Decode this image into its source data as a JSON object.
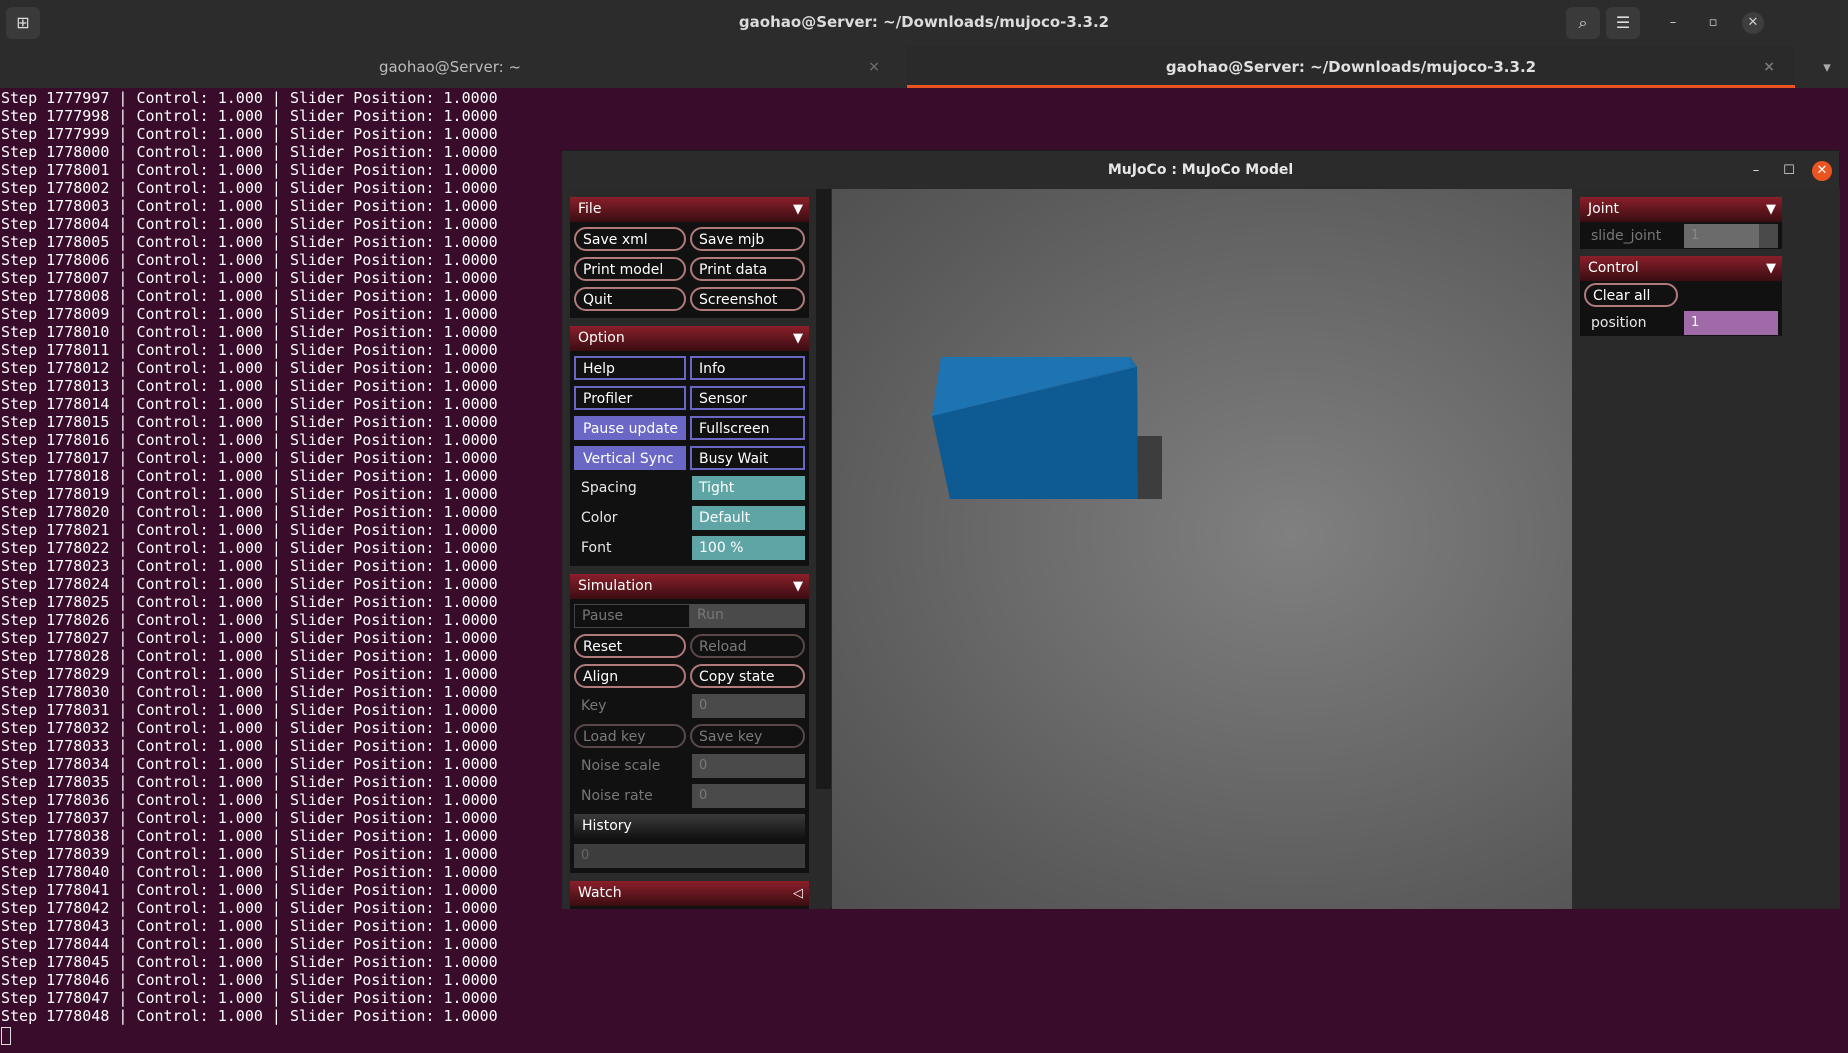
{
  "terminal_window": {
    "title": "gaohao@Server: ~/Downloads/mujoco-3.3.2",
    "tabs": [
      {
        "label": "gaohao@Server: ~",
        "active": false
      },
      {
        "label": "gaohao@Server: ~/Downloads/mujoco-3.3.2",
        "active": true
      }
    ],
    "icons": {
      "new_tab": "new-tab-icon",
      "search": "search-icon",
      "menu": "hamburger-menu-icon",
      "minimize": "minimize-icon",
      "maximize": "maximize-icon",
      "close": "close-icon",
      "tab_close": "×",
      "tab_dropdown": "▾"
    },
    "output_lines": [
      "Step 1777997 | Control: 1.000 | Slider Position: 1.0000",
      "Step 1777998 | Control: 1.000 | Slider Position: 1.0000",
      "Step 1777999 | Control: 1.000 | Slider Position: 1.0000",
      "Step 1778000 | Control: 1.000 | Slider Position: 1.0000",
      "Step 1778001 | Control: 1.000 | Slider Position: 1.0000",
      "Step 1778002 | Control: 1.000 | Slider Position: 1.0000",
      "Step 1778003 | Control: 1.000 | Slider Position: 1.0000",
      "Step 1778004 | Control: 1.000 | Slider Position: 1.0000",
      "Step 1778005 | Control: 1.000 | Slider Position: 1.0000",
      "Step 1778006 | Control: 1.000 | Slider Position: 1.0000",
      "Step 1778007 | Control: 1.000 | Slider Position: 1.0000",
      "Step 1778008 | Control: 1.000 | Slider Position: 1.0000",
      "Step 1778009 | Control: 1.000 | Slider Position: 1.0000",
      "Step 1778010 | Control: 1.000 | Slider Position: 1.0000",
      "Step 1778011 | Control: 1.000 | Slider Position: 1.0000",
      "Step 1778012 | Control: 1.000 | Slider Position: 1.0000",
      "Step 1778013 | Control: 1.000 | Slider Position: 1.0000",
      "Step 1778014 | Control: 1.000 | Slider Position: 1.0000",
      "Step 1778015 | Control: 1.000 | Slider Position: 1.0000",
      "Step 1778016 | Control: 1.000 | Slider Position: 1.0000",
      "Step 1778017 | Control: 1.000 | Slider Position: 1.0000",
      "Step 1778018 | Control: 1.000 | Slider Position: 1.0000",
      "Step 1778019 | Control: 1.000 | Slider Position: 1.0000",
      "Step 1778020 | Control: 1.000 | Slider Position: 1.0000",
      "Step 1778021 | Control: 1.000 | Slider Position: 1.0000",
      "Step 1778022 | Control: 1.000 | Slider Position: 1.0000",
      "Step 1778023 | Control: 1.000 | Slider Position: 1.0000",
      "Step 1778024 | Control: 1.000 | Slider Position: 1.0000",
      "Step 1778025 | Control: 1.000 | Slider Position: 1.0000",
      "Step 1778026 | Control: 1.000 | Slider Position: 1.0000",
      "Step 1778027 | Control: 1.000 | Slider Position: 1.0000",
      "Step 1778028 | Control: 1.000 | Slider Position: 1.0000",
      "Step 1778029 | Control: 1.000 | Slider Position: 1.0000",
      "Step 1778030 | Control: 1.000 | Slider Position: 1.0000",
      "Step 1778031 | Control: 1.000 | Slider Position: 1.0000",
      "Step 1778032 | Control: 1.000 | Slider Position: 1.0000",
      "Step 1778033 | Control: 1.000 | Slider Position: 1.0000",
      "Step 1778034 | Control: 1.000 | Slider Position: 1.0000",
      "Step 1778035 | Control: 1.000 | Slider Position: 1.0000",
      "Step 1778036 | Control: 1.000 | Slider Position: 1.0000",
      "Step 1778037 | Control: 1.000 | Slider Position: 1.0000",
      "Step 1778038 | Control: 1.000 | Slider Position: 1.0000",
      "Step 1778039 | Control: 1.000 | Slider Position: 1.0000",
      "Step 1778040 | Control: 1.000 | Slider Position: 1.0000",
      "Step 1778041 | Control: 1.000 | Slider Position: 1.0000",
      "Step 1778042 | Control: 1.000 | Slider Position: 1.0000",
      "Step 1778043 | Control: 1.000 | Slider Position: 1.0000",
      "Step 1778044 | Control: 1.000 | Slider Position: 1.0000",
      "Step 1778045 | Control: 1.000 | Slider Position: 1.0000",
      "Step 1778046 | Control: 1.000 | Slider Position: 1.0000",
      "Step 1778047 | Control: 1.000 | Slider Position: 1.0000",
      "Step 1778048 | Control: 1.000 | Slider Position: 1.0000"
    ]
  },
  "mujoco": {
    "title": "MuJoCo : MuJoCo Model",
    "window_controls": {
      "minimize": "–",
      "maximize": "☐",
      "close": "✕"
    },
    "file": {
      "header": "File",
      "buttons": [
        "Save xml",
        "Save mjb",
        "Print model",
        "Print data",
        "Quit",
        "Screenshot"
      ]
    },
    "option": {
      "header": "Option",
      "toggles": [
        {
          "label": "Help",
          "on": false
        },
        {
          "label": "Info",
          "on": false
        },
        {
          "label": "Profiler",
          "on": false
        },
        {
          "label": "Sensor",
          "on": false
        },
        {
          "label": "Pause update",
          "on": true
        },
        {
          "label": "Fullscreen",
          "on": false
        },
        {
          "label": "Vertical Sync",
          "on": true
        },
        {
          "label": "Busy Wait",
          "on": false
        }
      ],
      "selects": [
        {
          "label": "Spacing",
          "value": "Tight"
        },
        {
          "label": "Color",
          "value": "Default"
        },
        {
          "label": "Font",
          "value": "100 %"
        }
      ]
    },
    "simulation": {
      "header": "Simulation",
      "pause": "Pause",
      "run": "Run",
      "reset": "Reset",
      "reload": "Reload",
      "align": "Align",
      "copy_state": "Copy state",
      "key_label": "Key",
      "key_value": "0",
      "load_key": "Load key",
      "save_key": "Save key",
      "noise_scale_label": "Noise scale",
      "noise_scale_value": "0",
      "noise_rate_label": "Noise rate",
      "noise_rate_value": "0",
      "history_label": "History",
      "history_value": "0"
    },
    "watch": {
      "header": "Watch"
    },
    "joint": {
      "header": "Joint",
      "name": "slide_joint",
      "value": "1",
      "slider_fraction": 0.8
    },
    "control": {
      "header": "Control",
      "clear_all": "Clear all",
      "name": "position",
      "value": "1"
    },
    "colors": {
      "section_header": "#8a1f2a",
      "toggle_on": "#6a67c6",
      "select": "#5fa5a5",
      "control_slider": "#a06aa8",
      "box_top": "#2a7fc0",
      "box_front": "#0e5a92",
      "box_side": "#0a3550"
    }
  }
}
